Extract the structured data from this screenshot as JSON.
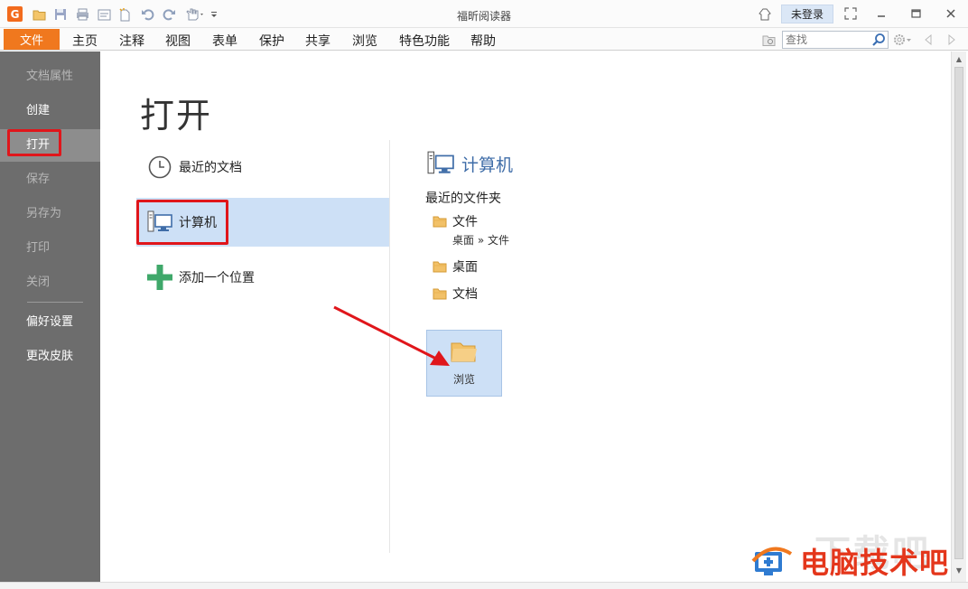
{
  "window": {
    "title": "福昕阅读器",
    "login_label": "未登录"
  },
  "menubar": {
    "file_tab": "文件",
    "items": [
      "主页",
      "注释",
      "视图",
      "表单",
      "保护",
      "共享",
      "浏览",
      "特色功能",
      "帮助"
    ],
    "search_placeholder": "查找"
  },
  "leftnav": {
    "items": [
      "文档属性",
      "创建",
      "打开",
      "保存",
      "另存为",
      "打印",
      "关闭",
      "偏好设置",
      "更改皮肤"
    ]
  },
  "main": {
    "title": "打开",
    "places": [
      "最近的文档",
      "计算机",
      "添加一个位置"
    ],
    "right_title": "计算机",
    "recent_folders_label": "最近的文件夹",
    "folders": [
      {
        "name": "文件",
        "path": "桌面 » 文件"
      },
      {
        "name": "桌面"
      },
      {
        "name": "文档"
      }
    ],
    "browse_label": "浏览"
  },
  "watermark": {
    "text": "电脑技术吧",
    "faint_text": "下载吧"
  },
  "colors": {
    "accent": "#f0781e",
    "selection": "#cde0f6",
    "sidebar": "#6d6d6d",
    "highlight": "#e0161b",
    "link_blue": "#3f6da8"
  }
}
